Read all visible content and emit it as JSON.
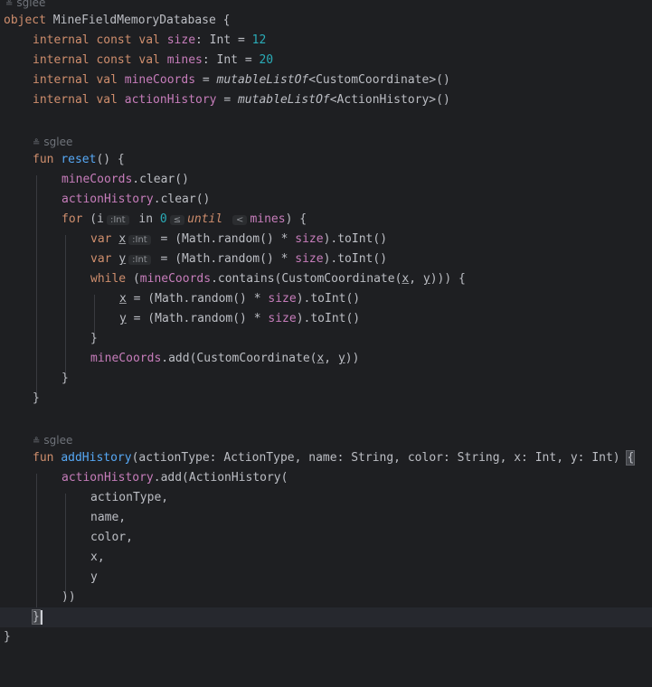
{
  "editor": {
    "authors": {
      "object": "sglee",
      "reset": "sglee",
      "add_history": "sglee"
    },
    "hints": {
      "i": ":Int",
      "x": ":Int",
      "y": ":Int",
      "le": "≤",
      "lt": "<"
    },
    "code": {
      "l1": {
        "kw": "object",
        "name": " MineFieldMemoryDatabase {"
      },
      "l2": {
        "kw": "internal const val ",
        "prop": "size",
        "rest": ": Int = ",
        "num": "12"
      },
      "l3": {
        "kw": "internal const val ",
        "prop": "mines",
        "rest": ": Int = ",
        "num": "20"
      },
      "l4": {
        "kw": "internal val ",
        "prop": "mineCoords",
        "eq": " = ",
        "call": "mutableListOf",
        "rest": "<CustomCoordinate>()"
      },
      "l5": {
        "kw": "internal val ",
        "prop": "actionHistory",
        "eq": " = ",
        "call": "mutableListOf",
        "rest": "<ActionHistory>()"
      },
      "l7": {
        "kw": "fun ",
        "fn": "reset",
        "rest": "() {"
      },
      "l8": {
        "prop": "mineCoords",
        "rest": ".clear()"
      },
      "l9": {
        "prop": "actionHistory",
        "rest": ".clear()"
      },
      "l10": {
        "kw": "for",
        "a": " (i",
        "b": " in ",
        "num": "0",
        "c": " ",
        "kw2": "until",
        "d": " ",
        "prop": "mines",
        "e": ") {"
      },
      "l11": {
        "kw": "var ",
        "var": "x",
        "a": " = (Math.random() * ",
        "prop": "size",
        "b": ").toInt()"
      },
      "l12": {
        "kw": "var ",
        "var": "y",
        "a": " = (Math.random() * ",
        "prop": "size",
        "b": ").toInt()"
      },
      "l13": {
        "kw": "while",
        "a": " (",
        "prop": "mineCoords",
        "b": ".contains(CustomCoordinate(",
        "x": "x",
        "c": ", ",
        "y": "y",
        "d": "))) {"
      },
      "l14": {
        "var": "x",
        "a": " = (Math.random() * ",
        "prop": "size",
        "b": ").toInt()"
      },
      "l15": {
        "var": "y",
        "a": " = (Math.random() * ",
        "prop": "size",
        "b": ").toInt()"
      },
      "l16": "}",
      "l17": {
        "prop": "mineCoords",
        "a": ".add(CustomCoordinate(",
        "x": "x",
        "b": ", ",
        "y": "y",
        "c": "))"
      },
      "l18": "}",
      "l19": "}",
      "l21": {
        "kw": "fun ",
        "fn": "addHistory",
        "rest": "(actionType: ActionType, name: String, color: String, x: Int, y: Int) ",
        "brace": "{"
      },
      "l22": {
        "prop": "actionHistory",
        "rest": ".add(ActionHistory("
      },
      "l23": "actionType,",
      "l24": "name,",
      "l25": "color,",
      "l26": "x,",
      "l27": "y",
      "l28": "))",
      "l29": "}",
      "l30": "}"
    }
  }
}
